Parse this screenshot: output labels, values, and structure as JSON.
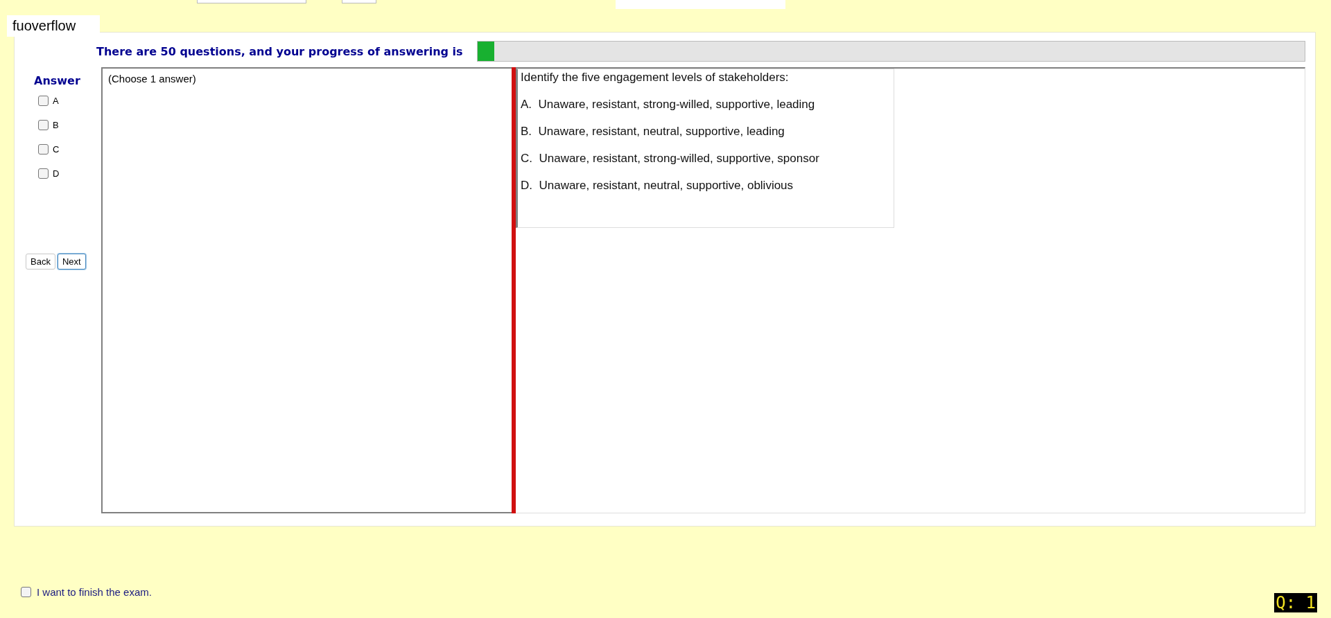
{
  "user_field": {
    "value": "fuoverflow"
  },
  "progress": {
    "label": "There are 50 questions, and your progress of answering is",
    "level": 0.02
  },
  "answer_panel": {
    "title": "Answer",
    "options": [
      {
        "label": "A",
        "checked": false
      },
      {
        "label": "B",
        "checked": false
      },
      {
        "label": "C",
        "checked": false
      },
      {
        "label": "D",
        "checked": false
      }
    ],
    "buttons": [
      {
        "label": "Back",
        "focused": false
      },
      {
        "label": "Next",
        "focused": true
      }
    ]
  },
  "instruction": "(Choose 1 answer)",
  "question": {
    "prompt": "Identify the five engagement levels of stakeholders:",
    "choices": [
      "A.  Unaware, resistant, strong-willed, supportive, leading",
      "B.  Unaware, resistant, neutral, supportive, leading",
      "C.  Unaware, resistant, strong-willed, supportive, sponsor",
      "D.  Unaware, resistant, neutral, supportive, oblivious"
    ]
  },
  "finish": {
    "label": "I want to finish the exam.",
    "checked": false
  },
  "question_badge": "Q: 1"
}
